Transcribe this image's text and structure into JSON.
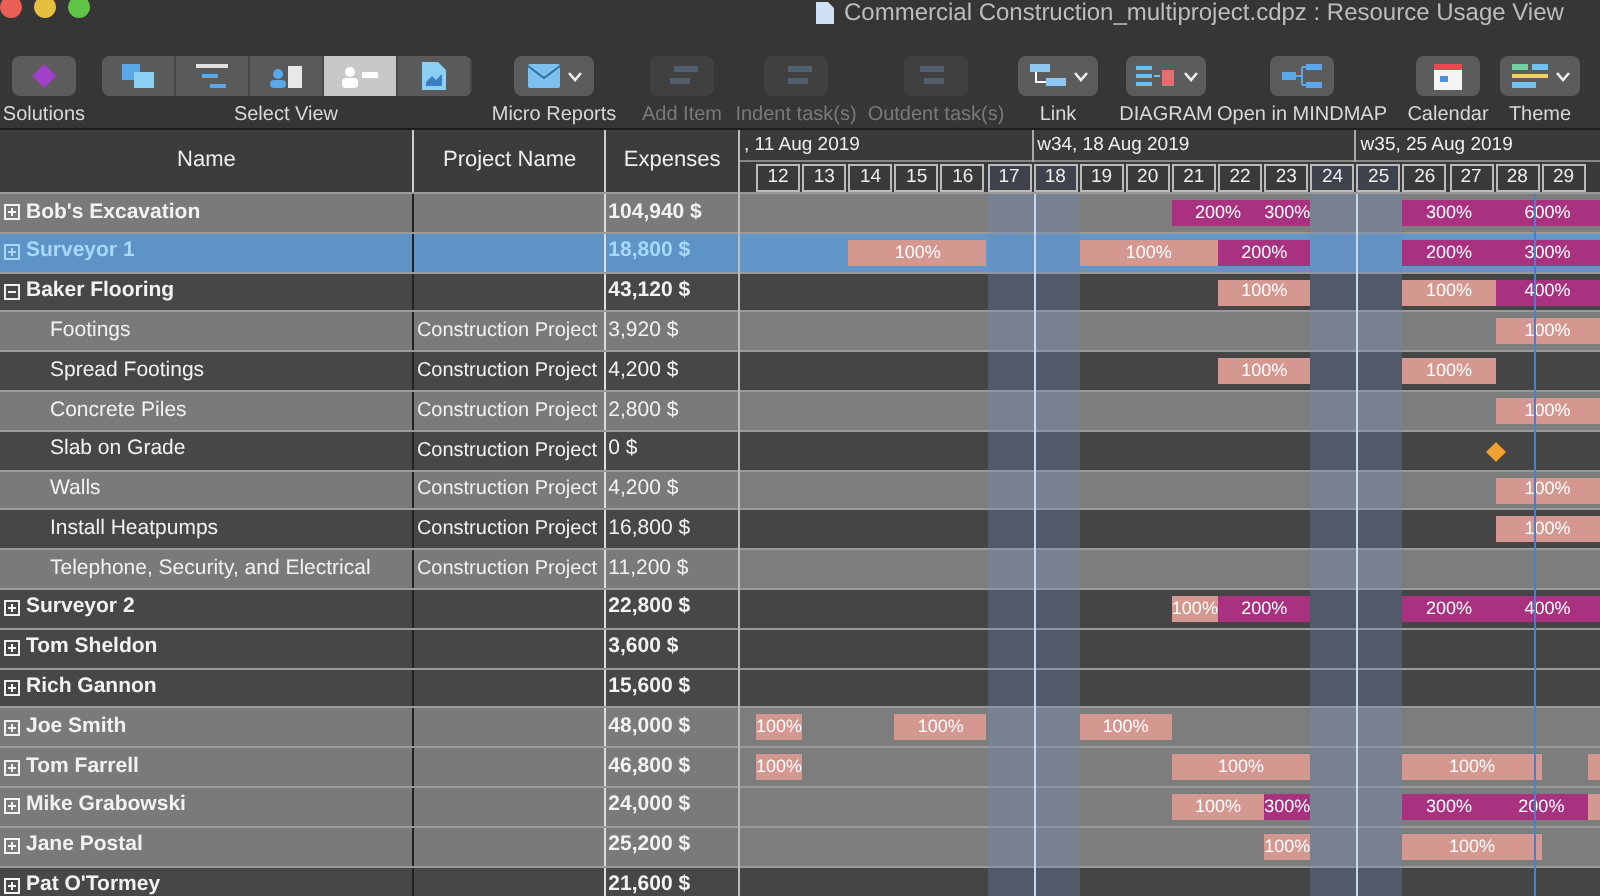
{
  "window": {
    "title": "Commercial Construction_multiproject.cdpz : Resource Usage View"
  },
  "toolbar": [
    {
      "kind": "solutions",
      "label": "Solutions",
      "disabled": false,
      "dropdown": false
    },
    {
      "kind": "views",
      "label": "Select View",
      "views": [
        {
          "selected": false
        },
        {
          "selected": false
        },
        {
          "selected": false
        },
        {
          "selected": true
        },
        {
          "selected": false
        }
      ]
    },
    {
      "kind": "report",
      "label": "Micro Reports",
      "disabled": false,
      "dropdown": true
    },
    {
      "kind": "add",
      "label": "Add Item",
      "disabled": true,
      "dropdown": false
    },
    {
      "kind": "indent",
      "label": "Indent task(s)",
      "disabled": true,
      "dropdown": false
    },
    {
      "kind": "outdent",
      "label": "Outdent task(s)",
      "disabled": true,
      "dropdown": false
    },
    {
      "kind": "link",
      "label": "Link",
      "disabled": false,
      "dropdown": true
    },
    {
      "kind": "diagram",
      "label": "DIAGRAM",
      "disabled": false,
      "dropdown": true
    },
    {
      "kind": "mindmap",
      "label": "Open in MINDMAP",
      "disabled": false,
      "dropdown": false
    },
    {
      "kind": "calendar",
      "label": "Calendar",
      "disabled": false,
      "dropdown": false
    },
    {
      "kind": "theme",
      "label": "Theme",
      "disabled": false,
      "dropdown": true
    }
  ],
  "table": {
    "columns": [
      "Name",
      "Project Name",
      "Expenses"
    ],
    "rows": [
      {
        "kind": "group",
        "name": "Bob's Excavation",
        "expenses": "104,940 $",
        "expanded": false,
        "selected": false,
        "light": true,
        "cells": [
          {
            "kind": "none"
          },
          {
            "kind": "none"
          },
          {
            "kind": "none"
          },
          {
            "kind": "none"
          },
          {
            "kind": "none"
          },
          {
            "kind": "none"
          },
          {
            "kind": "none"
          },
          {
            "kind": "none"
          },
          {
            "kind": "none"
          },
          {
            "kind": "over",
            "label": "200%"
          },
          {
            "kind": "over"
          },
          {
            "kind": "over",
            "label": "300%"
          },
          {
            "kind": "none"
          },
          {
            "kind": "none"
          },
          {
            "kind": "over",
            "label": "300%"
          },
          {
            "kind": "over"
          },
          {
            "kind": "over",
            "label": "600%"
          },
          {
            "kind": "over"
          },
          {
            "kind": "over"
          }
        ]
      },
      {
        "kind": "group",
        "name": "Surveyor 1",
        "expenses": "18,800 $",
        "expanded": false,
        "selected": true,
        "light": true,
        "cells": [
          {
            "kind": "none"
          },
          {
            "kind": "none"
          },
          {
            "kind": "normal",
            "label": "100%"
          },
          {
            "kind": "normal"
          },
          {
            "kind": "normal"
          },
          {
            "kind": "none"
          },
          {
            "kind": "none"
          },
          {
            "kind": "normal",
            "label": "100%"
          },
          {
            "kind": "normal"
          },
          {
            "kind": "normal"
          },
          {
            "kind": "over",
            "label": "200%"
          },
          {
            "kind": "over"
          },
          {
            "kind": "none"
          },
          {
            "kind": "none"
          },
          {
            "kind": "over",
            "label": "200%"
          },
          {
            "kind": "over"
          },
          {
            "kind": "over",
            "label": "300%"
          },
          {
            "kind": "over"
          },
          {
            "kind": "over"
          }
        ]
      },
      {
        "kind": "group",
        "name": "Baker Flooring",
        "expenses": "43,120 $",
        "expanded": true,
        "selected": false,
        "light": false,
        "cells": [
          {
            "kind": "none"
          },
          {
            "kind": "none"
          },
          {
            "kind": "none"
          },
          {
            "kind": "none"
          },
          {
            "kind": "none"
          },
          {
            "kind": "none"
          },
          {
            "kind": "none"
          },
          {
            "kind": "none"
          },
          {
            "kind": "none"
          },
          {
            "kind": "none"
          },
          {
            "kind": "normal",
            "label": "100%"
          },
          {
            "kind": "normal"
          },
          {
            "kind": "none"
          },
          {
            "kind": "none"
          },
          {
            "kind": "normal",
            "label": "100%"
          },
          {
            "kind": "normal"
          },
          {
            "kind": "over",
            "label": "400%"
          },
          {
            "kind": "over"
          },
          {
            "kind": "over"
          }
        ]
      },
      {
        "kind": "task",
        "name": "Footings",
        "project": "Construction Project",
        "expenses": "3,920 $",
        "selected": false,
        "light": true,
        "cells": [
          {
            "kind": "none"
          },
          {
            "kind": "none"
          },
          {
            "kind": "none"
          },
          {
            "kind": "none"
          },
          {
            "kind": "none"
          },
          {
            "kind": "none"
          },
          {
            "kind": "none"
          },
          {
            "kind": "none"
          },
          {
            "kind": "none"
          },
          {
            "kind": "none"
          },
          {
            "kind": "none"
          },
          {
            "kind": "none"
          },
          {
            "kind": "none"
          },
          {
            "kind": "none"
          },
          {
            "kind": "none"
          },
          {
            "kind": "none"
          },
          {
            "kind": "normal",
            "label": "100%"
          },
          {
            "kind": "normal"
          },
          {
            "kind": "normal"
          }
        ]
      },
      {
        "kind": "task",
        "name": "Spread Footings",
        "project": "Construction Project",
        "expenses": "4,200 $",
        "selected": false,
        "light": false,
        "cells": [
          {
            "kind": "none"
          },
          {
            "kind": "none"
          },
          {
            "kind": "none"
          },
          {
            "kind": "none"
          },
          {
            "kind": "none"
          },
          {
            "kind": "none"
          },
          {
            "kind": "none"
          },
          {
            "kind": "none"
          },
          {
            "kind": "none"
          },
          {
            "kind": "none"
          },
          {
            "kind": "normal",
            "label": "100%"
          },
          {
            "kind": "normal"
          },
          {
            "kind": "none"
          },
          {
            "kind": "none"
          },
          {
            "kind": "normal",
            "label": "100%"
          },
          {
            "kind": "normal"
          }
        ]
      },
      {
        "kind": "task",
        "name": "Concrete Piles",
        "project": "Construction Project",
        "expenses": "2,800 $",
        "selected": false,
        "light": true,
        "cells": [
          {
            "kind": "none"
          },
          {
            "kind": "none"
          },
          {
            "kind": "none"
          },
          {
            "kind": "none"
          },
          {
            "kind": "none"
          },
          {
            "kind": "none"
          },
          {
            "kind": "none"
          },
          {
            "kind": "none"
          },
          {
            "kind": "none"
          },
          {
            "kind": "none"
          },
          {
            "kind": "none"
          },
          {
            "kind": "none"
          },
          {
            "kind": "none"
          },
          {
            "kind": "none"
          },
          {
            "kind": "none"
          },
          {
            "kind": "none"
          },
          {
            "kind": "normal",
            "label": "100%"
          },
          {
            "kind": "normal"
          },
          {
            "kind": "normal"
          }
        ]
      },
      {
        "kind": "task",
        "name": "Slab on Grade",
        "project": "Construction Project",
        "expenses": "0 $",
        "selected": false,
        "light": false,
        "cells": [
          {
            "kind": "none"
          },
          {
            "kind": "none"
          },
          {
            "kind": "none"
          },
          {
            "kind": "none"
          },
          {
            "kind": "none"
          },
          {
            "kind": "none"
          },
          {
            "kind": "none"
          },
          {
            "kind": "none"
          },
          {
            "kind": "none"
          },
          {
            "kind": "none"
          },
          {
            "kind": "none"
          },
          {
            "kind": "none"
          },
          {
            "kind": "none"
          },
          {
            "kind": "none"
          },
          {
            "kind": "none"
          },
          {
            "kind": "none"
          },
          {
            "kind": "milestone"
          }
        ]
      },
      {
        "kind": "task",
        "name": "Walls",
        "project": "Construction Project",
        "expenses": "4,200 $",
        "selected": false,
        "light": true,
        "cells": [
          {
            "kind": "none"
          },
          {
            "kind": "none"
          },
          {
            "kind": "none"
          },
          {
            "kind": "none"
          },
          {
            "kind": "none"
          },
          {
            "kind": "none"
          },
          {
            "kind": "none"
          },
          {
            "kind": "none"
          },
          {
            "kind": "none"
          },
          {
            "kind": "none"
          },
          {
            "kind": "none"
          },
          {
            "kind": "none"
          },
          {
            "kind": "none"
          },
          {
            "kind": "none"
          },
          {
            "kind": "none"
          },
          {
            "kind": "none"
          },
          {
            "kind": "normal",
            "label": "100%"
          },
          {
            "kind": "normal"
          },
          {
            "kind": "normal"
          }
        ]
      },
      {
        "kind": "task",
        "name": "Install Heatpumps",
        "project": "Construction Project",
        "expenses": "16,800 $",
        "selected": false,
        "light": false,
        "cells": [
          {
            "kind": "none"
          },
          {
            "kind": "none"
          },
          {
            "kind": "none"
          },
          {
            "kind": "none"
          },
          {
            "kind": "none"
          },
          {
            "kind": "none"
          },
          {
            "kind": "none"
          },
          {
            "kind": "none"
          },
          {
            "kind": "none"
          },
          {
            "kind": "none"
          },
          {
            "kind": "none"
          },
          {
            "kind": "none"
          },
          {
            "kind": "none"
          },
          {
            "kind": "none"
          },
          {
            "kind": "none"
          },
          {
            "kind": "none"
          },
          {
            "kind": "normal",
            "label": "100%"
          },
          {
            "kind": "normal"
          },
          {
            "kind": "normal"
          }
        ]
      },
      {
        "kind": "task",
        "name": "Telephone, Security, and Electrical",
        "project": "Construction Project",
        "expenses": "11,200 $",
        "selected": false,
        "light": true
      },
      {
        "kind": "group",
        "name": "Surveyor 2",
        "expenses": "22,800 $",
        "expanded": false,
        "selected": false,
        "light": false,
        "cells": [
          {
            "kind": "none"
          },
          {
            "kind": "none"
          },
          {
            "kind": "none"
          },
          {
            "kind": "none"
          },
          {
            "kind": "none"
          },
          {
            "kind": "none"
          },
          {
            "kind": "none"
          },
          {
            "kind": "none"
          },
          {
            "kind": "none"
          },
          {
            "kind": "normal",
            "label": "100%"
          },
          {
            "kind": "over",
            "label": "200%"
          },
          {
            "kind": "over"
          },
          {
            "kind": "none"
          },
          {
            "kind": "none"
          },
          {
            "kind": "over",
            "label": "200%"
          },
          {
            "kind": "over"
          },
          {
            "kind": "over",
            "label": "400%"
          },
          {
            "kind": "over"
          },
          {
            "kind": "over"
          }
        ]
      },
      {
        "kind": "group",
        "name": "Tom Sheldon",
        "expenses": "3,600 $",
        "expanded": false,
        "selected": false,
        "light": false
      },
      {
        "kind": "group",
        "name": "Rich Gannon",
        "expenses": "15,600 $",
        "expanded": false,
        "selected": false,
        "light": false
      },
      {
        "kind": "group",
        "name": "Joe Smith",
        "expenses": "48,000 $",
        "expanded": false,
        "selected": false,
        "light": true,
        "cells": [
          {
            "kind": "normal",
            "label": "100%"
          },
          {
            "kind": "none"
          },
          {
            "kind": "none"
          },
          {
            "kind": "normal",
            "label": "100%"
          },
          {
            "kind": "normal"
          },
          {
            "kind": "none"
          },
          {
            "kind": "none"
          },
          {
            "kind": "normal",
            "label": "100%"
          },
          {
            "kind": "normal"
          }
        ]
      },
      {
        "kind": "group",
        "name": "Tom Farrell",
        "expenses": "46,800 $",
        "expanded": false,
        "selected": false,
        "light": true,
        "cells": [
          {
            "kind": "normal",
            "label": "100%"
          },
          {
            "kind": "none"
          },
          {
            "kind": "none"
          },
          {
            "kind": "none"
          },
          {
            "kind": "none"
          },
          {
            "kind": "none"
          },
          {
            "kind": "none"
          },
          {
            "kind": "none"
          },
          {
            "kind": "none"
          },
          {
            "kind": "normal",
            "label": "100%"
          },
          {
            "kind": "normal"
          },
          {
            "kind": "normal"
          },
          {
            "kind": "none"
          },
          {
            "kind": "none"
          },
          {
            "kind": "normal",
            "label": "100%"
          },
          {
            "kind": "normal"
          },
          {
            "kind": "normal"
          },
          {
            "kind": "none"
          },
          {
            "kind": "normal"
          }
        ]
      },
      {
        "kind": "group",
        "name": "Mike Grabowski",
        "expenses": "24,000 $",
        "expanded": false,
        "selected": false,
        "light": true,
        "cells": [
          {
            "kind": "none"
          },
          {
            "kind": "none"
          },
          {
            "kind": "none"
          },
          {
            "kind": "none"
          },
          {
            "kind": "none"
          },
          {
            "kind": "none"
          },
          {
            "kind": "none"
          },
          {
            "kind": "none"
          },
          {
            "kind": "none"
          },
          {
            "kind": "normal",
            "label": "100%"
          },
          {
            "kind": "normal"
          },
          {
            "kind": "over",
            "label": "300%"
          },
          {
            "kind": "none"
          },
          {
            "kind": "none"
          },
          {
            "kind": "over",
            "label": "300%"
          },
          {
            "kind": "over"
          },
          {
            "kind": "over",
            "label": "200%"
          },
          {
            "kind": "over"
          },
          {
            "kind": "normal"
          }
        ]
      },
      {
        "kind": "group",
        "name": "Jane Postal",
        "expenses": "25,200 $",
        "expanded": false,
        "selected": false,
        "light": true,
        "cells": [
          {
            "kind": "none"
          },
          {
            "kind": "none"
          },
          {
            "kind": "none"
          },
          {
            "kind": "none"
          },
          {
            "kind": "none"
          },
          {
            "kind": "none"
          },
          {
            "kind": "none"
          },
          {
            "kind": "none"
          },
          {
            "kind": "none"
          },
          {
            "kind": "none"
          },
          {
            "kind": "none"
          },
          {
            "kind": "normal",
            "label": "100%"
          },
          {
            "kind": "none"
          },
          {
            "kind": "none"
          },
          {
            "kind": "normal",
            "label": "100%"
          },
          {
            "kind": "normal"
          },
          {
            "kind": "normal"
          }
        ]
      },
      {
        "kind": "group",
        "name": "Pat O'Tormey",
        "expenses": "21,600 $",
        "expanded": false,
        "selected": false,
        "light": false
      }
    ]
  },
  "timeline": {
    "weeks": [
      ", 11 Aug 2019",
      "w34, 18 Aug 2019",
      "w35, 25 Aug 2019"
    ],
    "days": [
      {
        "label": "12",
        "weekend": false
      },
      {
        "label": "13",
        "weekend": false
      },
      {
        "label": "14",
        "weekend": false
      },
      {
        "label": "15",
        "weekend": false
      },
      {
        "label": "16",
        "weekend": false
      },
      {
        "label": "17",
        "weekend": true
      },
      {
        "label": "18",
        "weekend": true
      },
      {
        "label": "19",
        "weekend": false
      },
      {
        "label": "20",
        "weekend": false
      },
      {
        "label": "21",
        "weekend": false
      },
      {
        "label": "22",
        "weekend": false
      },
      {
        "label": "23",
        "weekend": false
      },
      {
        "label": "24",
        "weekend": true
      },
      {
        "label": "25",
        "weekend": true
      },
      {
        "label": "26",
        "weekend": false
      },
      {
        "label": "27",
        "weekend": false
      },
      {
        "label": "28",
        "weekend": false
      },
      {
        "label": "29",
        "weekend": false
      }
    ]
  }
}
